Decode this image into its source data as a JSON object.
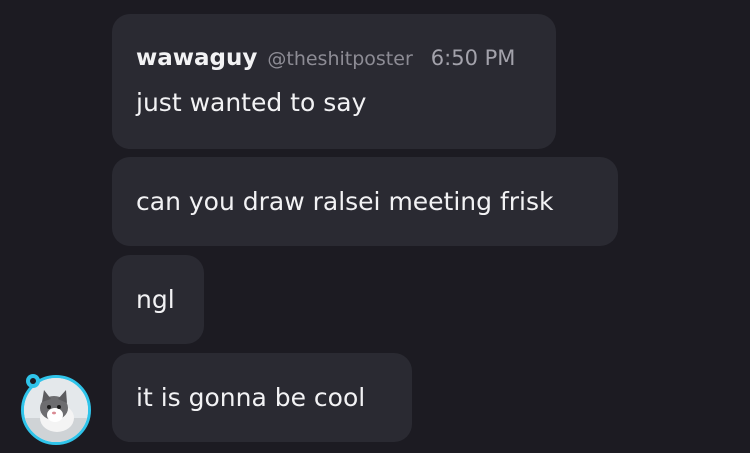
{
  "messages": [
    {
      "username": "wawaguy",
      "handle": "@theshitposter",
      "time": "6:50 PM",
      "text": "just wanted to say"
    },
    {
      "text": "can you draw ralsei meeting frisk"
    },
    {
      "text": "ngl"
    },
    {
      "text": "it is gonna be cool"
    }
  ],
  "avatar": {
    "icon": "cat-avatar",
    "badge_icon": "cyan-badge-icon",
    "ring_color": "#2fc4ea"
  }
}
